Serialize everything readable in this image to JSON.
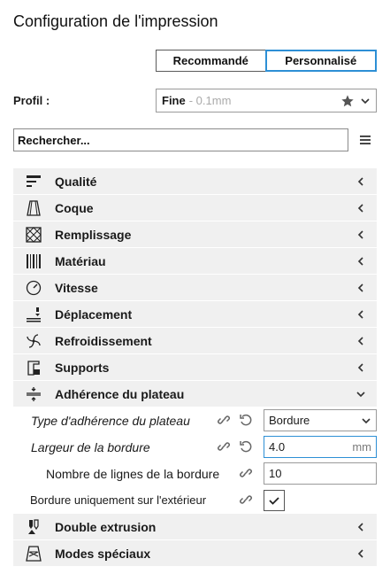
{
  "header": {
    "title": "Configuration de l'impression"
  },
  "mode_tabs": {
    "recommended": "Recommandé",
    "custom": "Personnalisé",
    "active": "custom"
  },
  "profile": {
    "label": "Profil :",
    "name": "Fine",
    "sub": "- 0.1mm"
  },
  "search": {
    "placeholder": "Rechercher..."
  },
  "categories": [
    {
      "label": "Qualité",
      "icon": "quality-icon"
    },
    {
      "label": "Coque",
      "icon": "shell-icon"
    },
    {
      "label": "Remplissage",
      "icon": "infill-icon"
    },
    {
      "label": "Matériau",
      "icon": "material-icon"
    },
    {
      "label": "Vitesse",
      "icon": "speed-icon"
    },
    {
      "label": "Déplacement",
      "icon": "travel-icon"
    },
    {
      "label": "Refroidissement",
      "icon": "cooling-icon"
    },
    {
      "label": "Supports",
      "icon": "support-icon"
    },
    {
      "label": "Adhérence du plateau",
      "icon": "adhesion-icon",
      "expanded": true
    },
    {
      "label": "Double extrusion",
      "icon": "dual-extrusion-icon"
    },
    {
      "label": "Modes spéciaux",
      "icon": "special-modes-icon"
    }
  ],
  "adhesion_settings": {
    "type": {
      "label": "Type d'adhérence du plateau",
      "value": "Bordure"
    },
    "width": {
      "label": "Largeur de la bordure",
      "value": "4.0",
      "unit": "mm"
    },
    "lines": {
      "label": "Nombre de lignes de la bordure",
      "value": "10"
    },
    "outside": {
      "label": "Bordure uniquement sur l'extérieur",
      "checked": true
    }
  }
}
